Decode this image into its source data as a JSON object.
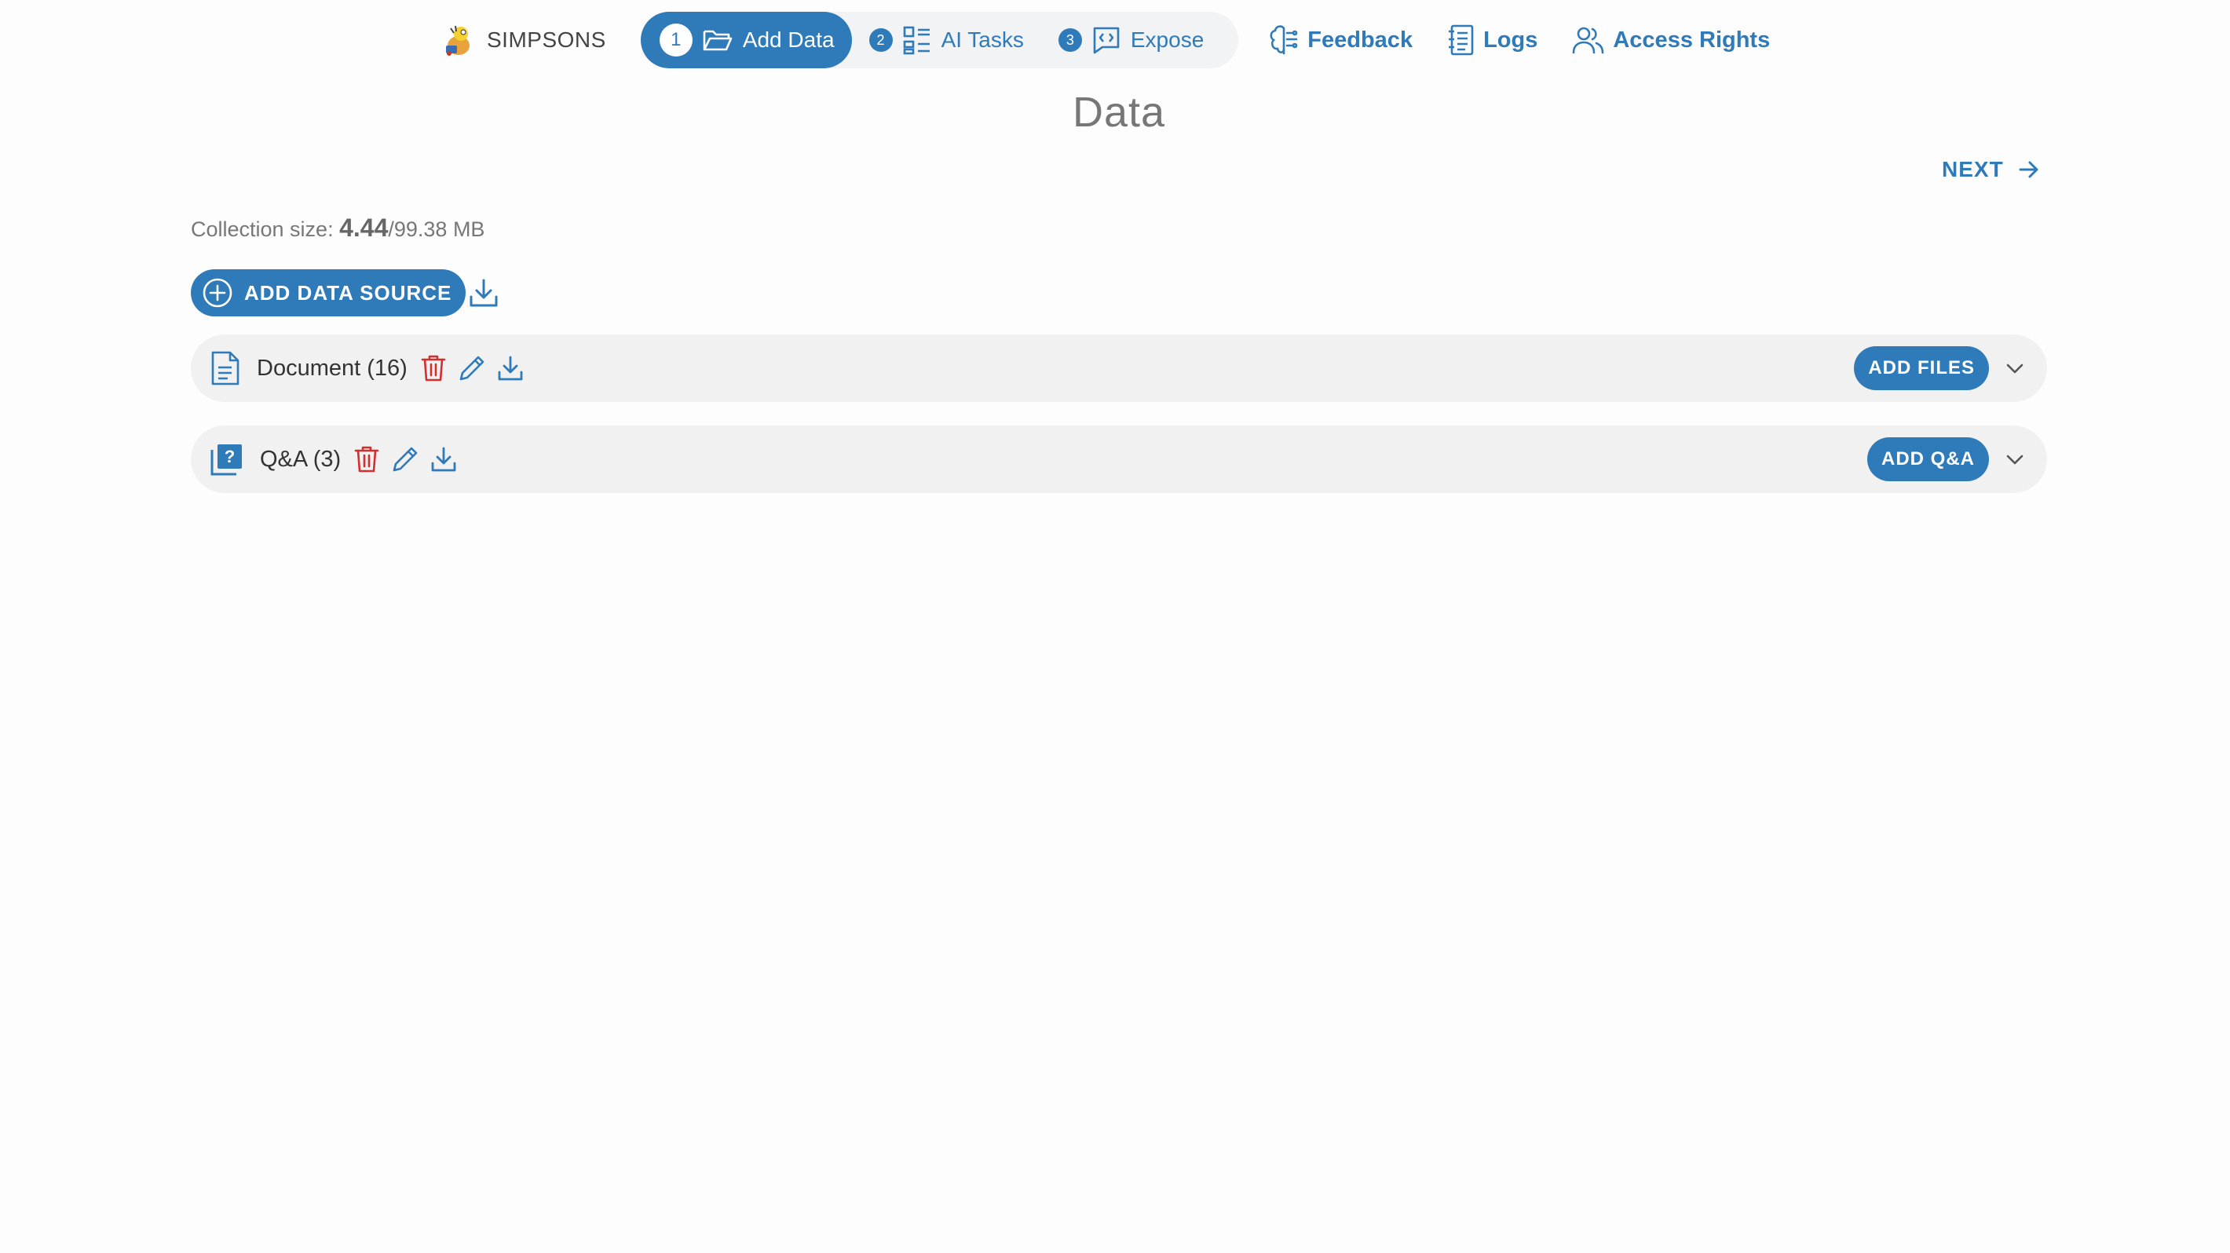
{
  "app": {
    "name": "SIMPSONS"
  },
  "steps": [
    {
      "num": "1",
      "label": "Add Data",
      "icon": "folder-icon",
      "active": true
    },
    {
      "num": "2",
      "label": "AI Tasks",
      "icon": "tasks-icon",
      "active": false
    },
    {
      "num": "3",
      "label": "Expose",
      "icon": "code-chat-icon",
      "active": false
    }
  ],
  "nav": {
    "feedback": "Feedback",
    "logs": "Logs",
    "access_rights": "Access Rights"
  },
  "page": {
    "title": "Data",
    "next_label": "NEXT"
  },
  "collection": {
    "label": "Collection size: ",
    "used": "4.44",
    "total": "/99.38 MB"
  },
  "actions": {
    "add_source": "ADD DATA SOURCE"
  },
  "sources": [
    {
      "title": "Document (16)",
      "button": "ADD FILES",
      "icon": "document-icon"
    },
    {
      "title": "Q&A (3)",
      "button": "ADD Q&A",
      "icon": "qa-icon"
    }
  ],
  "colors": {
    "accent": "#2f7ab8",
    "danger": "#d32f2f",
    "row_bg": "#f1f1f1",
    "title_gray": "#777777"
  }
}
